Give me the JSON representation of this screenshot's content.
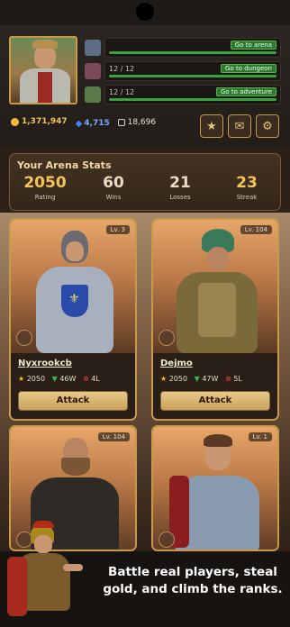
{
  "header": {
    "rows": [
      {
        "count": "",
        "action": "Go to arena"
      },
      {
        "count": "12 / 12",
        "action": "Go to dungeon"
      },
      {
        "count": "12 / 12",
        "action": "Go to adventure"
      }
    ],
    "currency": {
      "gold": "1,371,947",
      "gems": "4,715",
      "tickets": "18,696"
    },
    "buttons": {
      "star_icon": "star-icon",
      "mail_icon": "mail-icon",
      "settings_icon": "gear-icon"
    }
  },
  "arena_stats": {
    "title": "Your Arena Stats",
    "items": [
      {
        "value": "2050",
        "label": "Rating"
      },
      {
        "value": "60",
        "label": "Wins"
      },
      {
        "value": "21",
        "label": "Losses"
      },
      {
        "value": "23",
        "label": "Streak"
      }
    ]
  },
  "players": [
    {
      "level": "Lv. 3",
      "name": "Nyxrookcb",
      "rating": "2050",
      "wins": "46W",
      "losses": "4L",
      "action": "Attack"
    },
    {
      "level": "Lv. 104",
      "name": "Dejmo",
      "rating": "2050",
      "wins": "47W",
      "losses": "5L",
      "action": "Attack"
    },
    {
      "level": "Lv. 104",
      "name": "",
      "rating": "",
      "wins": "",
      "losses": "",
      "action": ""
    },
    {
      "level": "Lv. 1",
      "name": "",
      "rating": "",
      "wins": "",
      "losses": "",
      "action": ""
    }
  ],
  "banner": {
    "text": "Battle real players, steal gold, and climb the ranks."
  },
  "colors": {
    "accent_gold": "#f3c45a",
    "frame": "#c79a4b",
    "go_green": "#2d7a2e",
    "loss_red": "#e04040"
  }
}
